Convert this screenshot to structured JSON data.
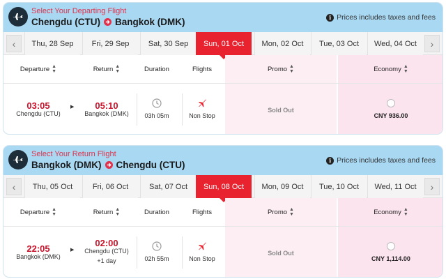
{
  "departing": {
    "caption": "Select Your Departing Flight",
    "origin": "Chengdu (CTU)",
    "destination": "Bangkok (DMK)",
    "note": "Prices includes taxes and fees",
    "dates": [
      "Thu, 28 Sep",
      "Fri, 29 Sep",
      "Sat, 30 Sep",
      "Sun, 01 Oct",
      "Mon, 02 Oct",
      "Tue, 03 Oct",
      "Wed, 04 Oct"
    ],
    "active_date_index": 3,
    "columns": {
      "departure": "Departure",
      "return": "Return",
      "duration": "Duration",
      "flights": "Flights",
      "promo": "Promo",
      "economy": "Economy"
    },
    "flight": {
      "dep_time": "03:05",
      "dep_place": "Chengdu (CTU)",
      "arr_time": "05:10",
      "arr_place": "Bangkok (DMK)",
      "arr_extra": "",
      "duration": "03h 05m",
      "flight_type": "Non Stop",
      "promo": "Sold Out",
      "economy_price": "CNY 936.00"
    }
  },
  "returning": {
    "caption": "Select Your Return Flight",
    "origin": "Bangkok (DMK)",
    "destination": "Chengdu (CTU)",
    "note": "Prices includes taxes and fees",
    "dates": [
      "Thu, 05 Oct",
      "Fri, 06 Oct",
      "Sat, 07 Oct",
      "Sun, 08 Oct",
      "Mon, 09 Oct",
      "Tue, 10 Oct",
      "Wed, 11 Oct"
    ],
    "active_date_index": 3,
    "columns": {
      "departure": "Departure",
      "return": "Return",
      "duration": "Duration",
      "flights": "Flights",
      "promo": "Promo",
      "economy": "Economy"
    },
    "flight": {
      "dep_time": "22:05",
      "dep_place": "Bangkok (DMK)",
      "arr_time": "02:00",
      "arr_place": "Chengdu (CTU)",
      "arr_extra": "+1 day",
      "duration": "02h 55m",
      "flight_type": "Non Stop",
      "promo": "Sold Out",
      "economy_price": "CNY 1,114.00"
    }
  },
  "colors": {
    "accent_red": "#e8222f",
    "header_blue": "#a9d8f2",
    "time_red": "#c8132b",
    "pink": "#fdeef4"
  },
  "icons": {
    "header": "airplane-icon",
    "route": "arrow-right-circle-icon",
    "note": "info-icon",
    "duration": "clock-icon",
    "flights": "airplane-icon"
  }
}
